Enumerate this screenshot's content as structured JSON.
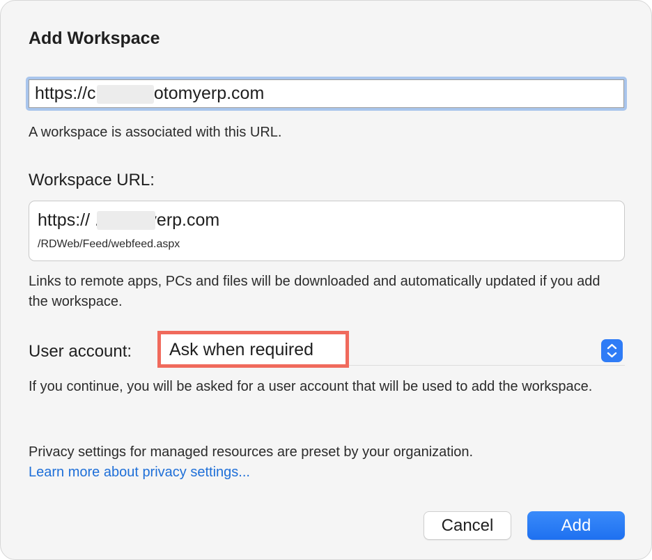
{
  "dialog": {
    "title": "Add Workspace"
  },
  "url_field": {
    "value": "https://c         .gotomyerp.com",
    "help": "A workspace is associated with this URL."
  },
  "workspace_url": {
    "label": "Workspace URL:",
    "host": "https://           .gotomyerp.com",
    "path": "/RDWeb/Feed/webfeed.aspx",
    "help": "Links to remote apps, PCs and files will be downloaded and automatically updated if you add the workspace."
  },
  "user_account": {
    "label": "User account:",
    "selected": "Ask when required",
    "help": "If you continue, you will be asked for a user account that will be used to add the workspace."
  },
  "privacy": {
    "text": "Privacy settings for managed resources are preset by your organization.",
    "link": "Learn more about privacy settings..."
  },
  "buttons": {
    "cancel": "Cancel",
    "add": "Add"
  },
  "colors": {
    "accent": "#2f7cf6",
    "link": "#1e6fd8",
    "annotation": "#f06a5c"
  },
  "icons": {
    "stepper": "chevron-up-down-icon"
  }
}
